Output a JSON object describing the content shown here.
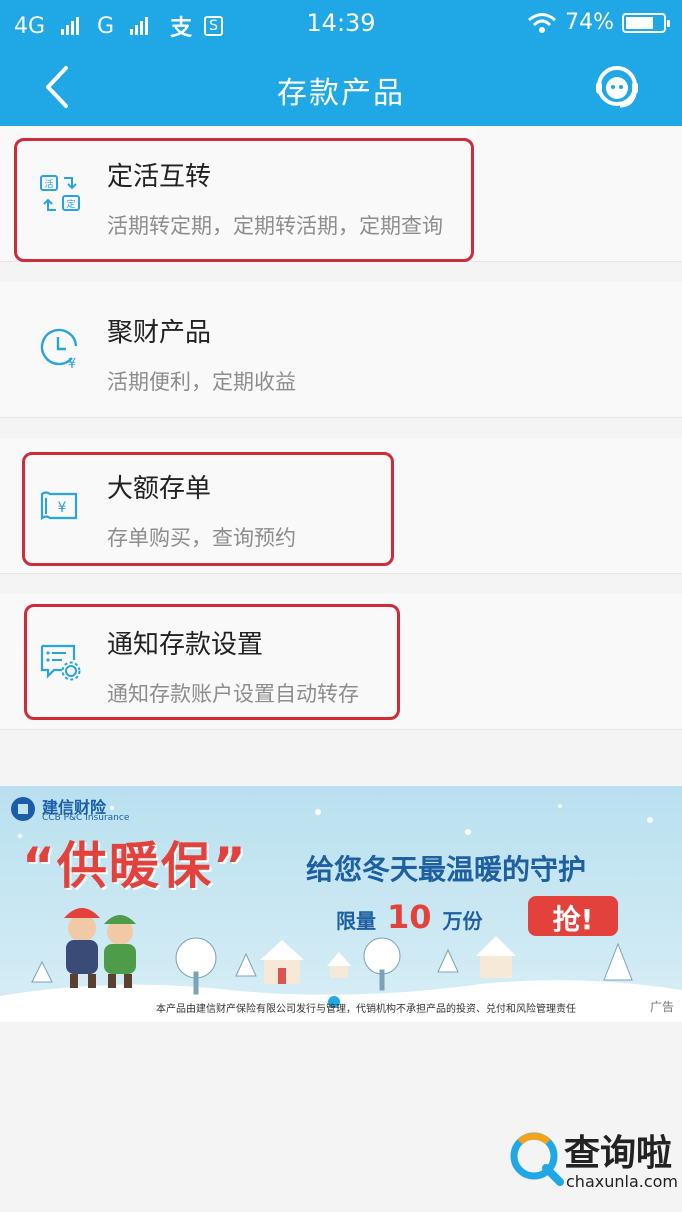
{
  "status": {
    "net1": "4G",
    "net2": "G",
    "app1": "支",
    "app2": "S",
    "time": "14:39",
    "battery": "74%",
    "battery_level": 0.74
  },
  "nav": {
    "title": "存款产品"
  },
  "items": [
    {
      "title": "定活互转",
      "sub": "活期转定期，定期转活期，定期查询",
      "icon": "transfer-icon",
      "icon_text_a": "活",
      "icon_text_b": "定"
    },
    {
      "title": "聚财产品",
      "sub": "活期便利，定期收益",
      "icon": "clock-yuan-icon",
      "icon_text_a": "¥"
    },
    {
      "title": "大额存单",
      "sub": "存单购买，查询预约",
      "icon": "certificate-icon",
      "icon_text_a": "¥"
    },
    {
      "title": "通知存款设置",
      "sub": "通知存款账户设置自动转存",
      "icon": "notice-settings-icon"
    }
  ],
  "banner": {
    "brand_cn": "建信财险",
    "brand_en": "CCB P&C Insurance",
    "headline": "“供暖保”",
    "slogan": "给您冬天最温暖的守护",
    "limit_pre": "限量",
    "limit_num": "10",
    "limit_post": "万份",
    "cta": "抢!",
    "disclaimer": "本产品由建信财产保险有限公司发行与管理，代销机构不承担产品的投资、兑付和风险管理责任",
    "ad_tag": "广告"
  },
  "watermark": {
    "cn": "查询啦",
    "url": "chaxunla.com"
  },
  "colors": {
    "brand_blue": "#1fa7e6",
    "highlight_red": "#cf2b39",
    "banner_red": "#e3413c"
  }
}
